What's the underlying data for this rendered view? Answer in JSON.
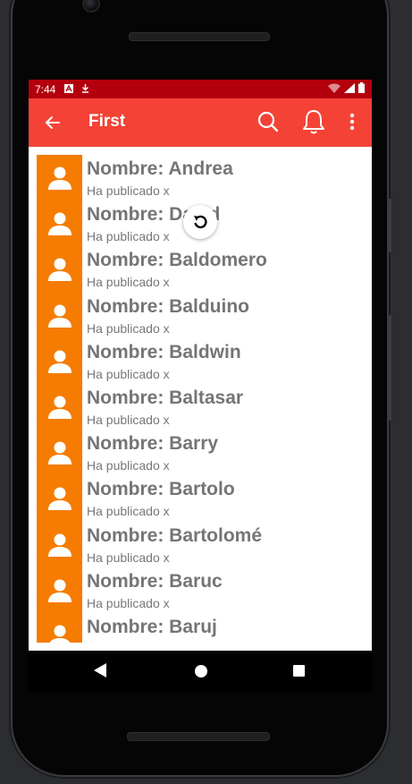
{
  "status_bar": {
    "time": "7:44",
    "icons_left": [
      "a-icon",
      "download-icon"
    ],
    "icons_right": [
      "wifi-icon",
      "signal-icon",
      "battery-icon"
    ],
    "color": "#b3000c"
  },
  "app_bar": {
    "title": "First",
    "color": "#f44336",
    "actions": [
      "search-icon",
      "bell-icon",
      "more-vert-icon"
    ]
  },
  "list": {
    "avatar_color": "#f57c00",
    "items": [
      {
        "name": "Nombre: Andrea",
        "subtitle": "Ha publicado x"
      },
      {
        "name": "Nombre: David",
        "subtitle": "Ha publicado x"
      },
      {
        "name": "Nombre: Baldomero",
        "subtitle": "Ha publicado x"
      },
      {
        "name": "Nombre: Balduino",
        "subtitle": "Ha publicado x"
      },
      {
        "name": "Nombre: Baldwin",
        "subtitle": "Ha publicado x"
      },
      {
        "name": "Nombre: Baltasar",
        "subtitle": "Ha publicado x"
      },
      {
        "name": "Nombre: Barry",
        "subtitle": "Ha publicado x"
      },
      {
        "name": "Nombre: Bartolo",
        "subtitle": "Ha publicado x"
      },
      {
        "name": "Nombre: Bartolomé",
        "subtitle": "Ha publicado x"
      },
      {
        "name": "Nombre: Baruc",
        "subtitle": "Ha publicado x"
      },
      {
        "name": "Nombre: Baruj",
        "subtitle": ""
      }
    ]
  },
  "refresh_indicator": "refresh-icon",
  "nav_bar": [
    "back-triangle-icon",
    "home-circle-icon",
    "recents-square-icon"
  ]
}
